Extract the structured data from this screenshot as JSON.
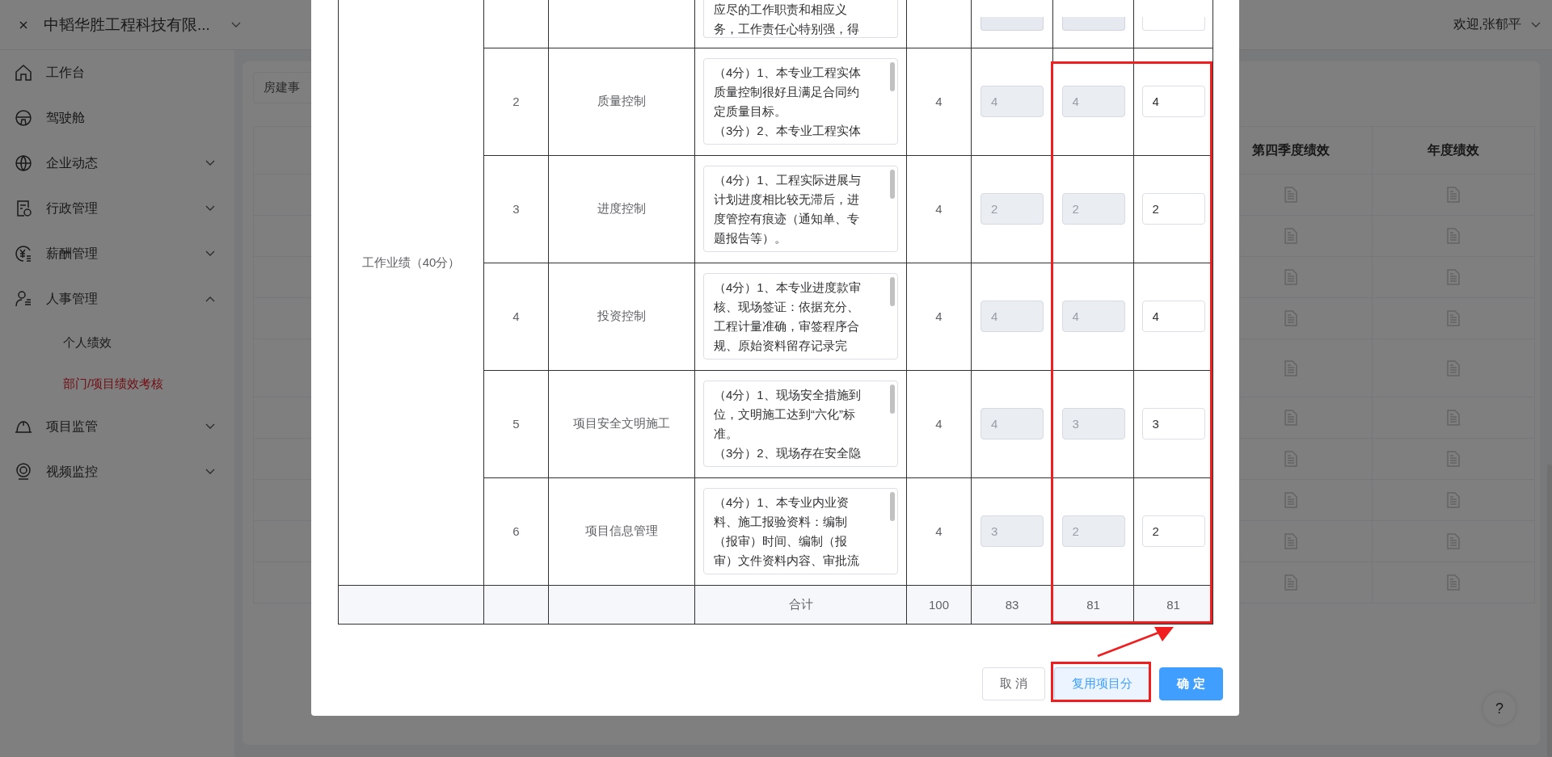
{
  "header": {
    "company": "中韬华胜工程科技有限...",
    "user": "欢迎,张郁平"
  },
  "sidebar": {
    "items": [
      {
        "label": "工作台"
      },
      {
        "label": "驾驶舱"
      },
      {
        "label": "企业动态",
        "expanded": false
      },
      {
        "label": "行政管理",
        "expanded": false
      },
      {
        "label": "薪酬管理",
        "expanded": false
      },
      {
        "label": "人事管理",
        "expanded": true,
        "children": [
          {
            "label": "个人绩效",
            "selected": false
          },
          {
            "label": "部门/项目绩效考核",
            "selected": true
          }
        ]
      },
      {
        "label": "项目监管",
        "expanded": false
      },
      {
        "label": "视频监控",
        "expanded": false
      }
    ]
  },
  "background": {
    "tab": "房建事",
    "columns": [
      "第四季度绩效",
      "年度绩效"
    ]
  },
  "dialog": {
    "category": "工作业绩（40分）",
    "rows": [
      {
        "kind": "partial",
        "criteria": [
          "应尽的工作职责和相应义务，工作责任心特别强，得"
        ],
        "scores": [
          {
            "disabled": true
          },
          {
            "disabled": true
          },
          {
            "disabled": false
          }
        ]
      },
      {
        "kind": "full",
        "index": "2",
        "name": "质量控制",
        "criteria": [
          "（4分）1、本专业工程实体质量控制很好且满足合同约定质量目标。",
          "（3分）2、本专业工程实体"
        ],
        "full": "4",
        "scores": [
          {
            "value": "4",
            "disabled": true
          },
          {
            "value": "4",
            "disabled": true
          },
          {
            "value": "4",
            "disabled": false
          }
        ]
      },
      {
        "kind": "full",
        "index": "3",
        "name": "进度控制",
        "criteria": [
          "（4分）1、工程实际进展与计划进度相比较无滞后，进度管控有痕迹（通知单、专题报告等）。"
        ],
        "full": "4",
        "scores": [
          {
            "value": "2",
            "disabled": true
          },
          {
            "value": "2",
            "disabled": true
          },
          {
            "value": "2",
            "disabled": false
          }
        ]
      },
      {
        "kind": "full",
        "index": "4",
        "name": "投资控制",
        "criteria": [
          "（4分）1、本专业进度款审核、现场签证：依据充分、工程计量准确，审签程序合规、原始资料留存记录完"
        ],
        "full": "4",
        "scores": [
          {
            "value": "4",
            "disabled": true
          },
          {
            "value": "4",
            "disabled": true
          },
          {
            "value": "4",
            "disabled": false
          }
        ]
      },
      {
        "kind": "full",
        "index": "5",
        "name": "项目安全文明施工",
        "criteria": [
          "（4分）1、现场安全措施到位，文明施工达到“六化”标准。",
          "（3分）2、现场存在安全隐"
        ],
        "full": "4",
        "scores": [
          {
            "value": "4",
            "disabled": true
          },
          {
            "value": "3",
            "disabled": true
          },
          {
            "value": "3",
            "disabled": false
          }
        ]
      },
      {
        "kind": "full",
        "index": "6",
        "name": "项目信息管理",
        "criteria": [
          "（4分）1、本专业内业资料、施工报验资料：编制（报审）时间、编制（报审）文件资料内容、审批流"
        ],
        "full": "4",
        "scores": [
          {
            "value": "3",
            "disabled": true
          },
          {
            "value": "2",
            "disabled": true
          },
          {
            "value": "2",
            "disabled": false
          }
        ]
      }
    ],
    "total": {
      "label": "合计",
      "full": "100",
      "scores": [
        "83",
        "81",
        "81"
      ]
    },
    "buttons": [
      {
        "label": "取 消",
        "kind": "default"
      },
      {
        "label": "复用项目分",
        "kind": "plain"
      },
      {
        "label": "确 定",
        "kind": "primary"
      }
    ]
  },
  "help": "?"
}
